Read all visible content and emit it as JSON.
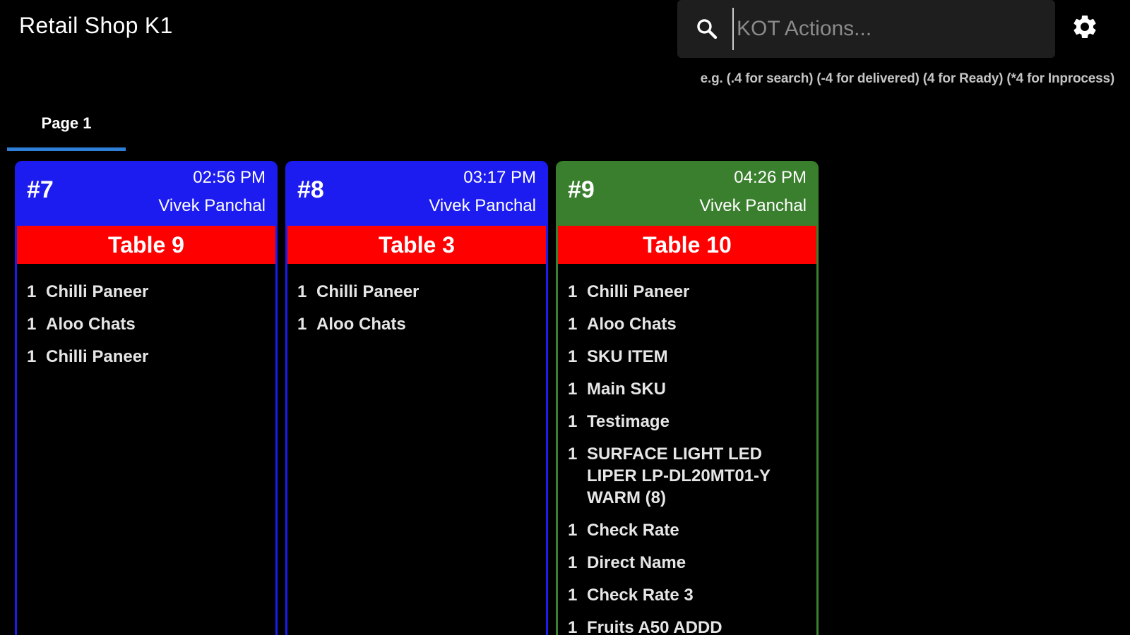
{
  "app": {
    "title": "Retail Shop  K1"
  },
  "search": {
    "placeholder": "KOT Actions...",
    "value": ""
  },
  "hint": "e.g. (.4 for search) (-4 for delivered) (4 for Ready) (*4 for Inprocess)",
  "tabs": [
    {
      "label": "Page 1",
      "selected": true
    }
  ],
  "colors": {
    "background": "#000000",
    "card_blue": "#1c1cf0",
    "card_green": "#3a7f2e",
    "table_red": "#ff0000",
    "tab_underline": "#2f7fd6"
  },
  "icons": {
    "search": "search-icon",
    "settings": "gear-icon"
  },
  "orders": [
    {
      "number": "#7",
      "time": "02:56 PM",
      "waiter": "Vivek Panchal",
      "table": "Table 9",
      "status_color": "#1c1cf0",
      "items": [
        {
          "qty": "1",
          "name": "Chilli Paneer"
        },
        {
          "qty": "1",
          "name": "Aloo Chats"
        },
        {
          "qty": "1",
          "name": "Chilli Paneer"
        }
      ]
    },
    {
      "number": "#8",
      "time": "03:17 PM",
      "waiter": "Vivek Panchal",
      "table": "Table 3",
      "status_color": "#1c1cf0",
      "items": [
        {
          "qty": "1",
          "name": "Chilli Paneer"
        },
        {
          "qty": "1",
          "name": "Aloo Chats"
        }
      ]
    },
    {
      "number": "#9",
      "time": "04:26 PM",
      "waiter": "Vivek Panchal",
      "table": "Table 10",
      "status_color": "#3a7f2e",
      "items": [
        {
          "qty": "1",
          "name": "Chilli Paneer"
        },
        {
          "qty": "1",
          "name": "Aloo Chats"
        },
        {
          "qty": "1",
          "name": "SKU ITEM"
        },
        {
          "qty": "1",
          "name": "Main SKU"
        },
        {
          "qty": "1",
          "name": "Testimage"
        },
        {
          "qty": "1",
          "name": "SURFACE LIGHT LED LIPER LP-DL20MT01-Y WARM (8)"
        },
        {
          "qty": "1",
          "name": "Check Rate"
        },
        {
          "qty": "1",
          "name": "Direct Name"
        },
        {
          "qty": "1",
          "name": "Check Rate 3"
        },
        {
          "qty": "1",
          "name": "Fruits A50 ADDD"
        }
      ]
    }
  ]
}
